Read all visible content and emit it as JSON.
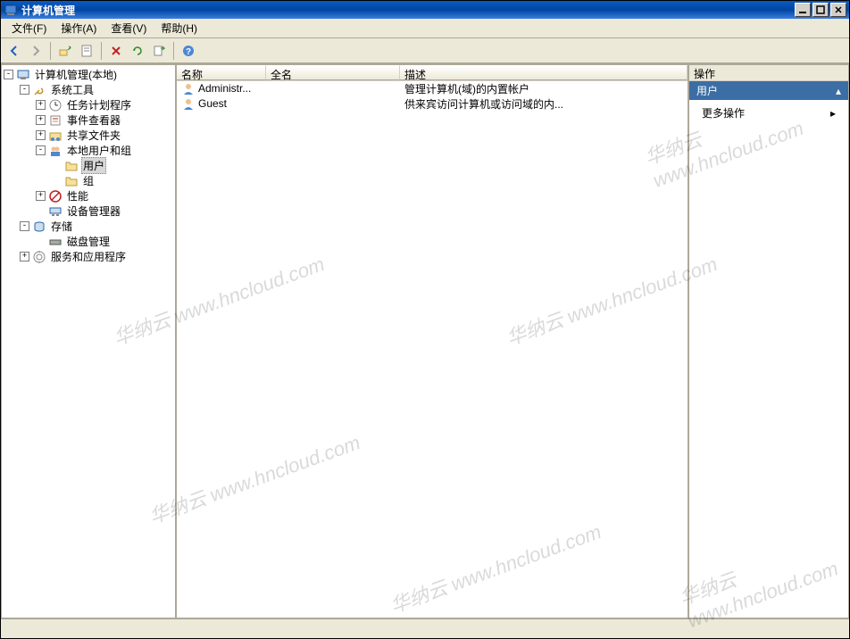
{
  "title": "计算机管理",
  "menubar": {
    "file": "文件(F)",
    "action": "操作(A)",
    "view": "查看(V)",
    "help": "帮助(H)"
  },
  "toolbar": {
    "back": "back",
    "forward": "forward",
    "up": "up",
    "props": "props",
    "delete": "delete",
    "refresh": "refresh",
    "export": "export",
    "help": "help"
  },
  "tree": {
    "root": "计算机管理(本地)",
    "system_tools": "系统工具",
    "task_scheduler": "任务计划程序",
    "event_viewer": "事件查看器",
    "shared_folders": "共享文件夹",
    "local_users": "本地用户和组",
    "users": "用户",
    "groups": "组",
    "performance": "性能",
    "device_manager": "设备管理器",
    "storage": "存储",
    "disk_mgmt": "磁盘管理",
    "services_apps": "服务和应用程序"
  },
  "list": {
    "headers": {
      "name": "名称",
      "fullname": "全名",
      "desc": "描述"
    },
    "rows": [
      {
        "name": "Administr...",
        "fullname": "",
        "desc": "管理计算机(域)的内置帐户"
      },
      {
        "name": "Guest",
        "fullname": "",
        "desc": "供来宾访问计算机或访问域的内..."
      }
    ]
  },
  "actions": {
    "header": "操作",
    "section": "用户",
    "more": "更多操作"
  },
  "watermarks": [
    "华纳云 www.hncloud.com",
    "华纳云 www.hncloud.com",
    "华纳云 www.hncloud.com",
    "华纳云 www.hncloud.com",
    "华纳云 www.hncloud.com",
    "华纳云 www.hncloud.com"
  ]
}
